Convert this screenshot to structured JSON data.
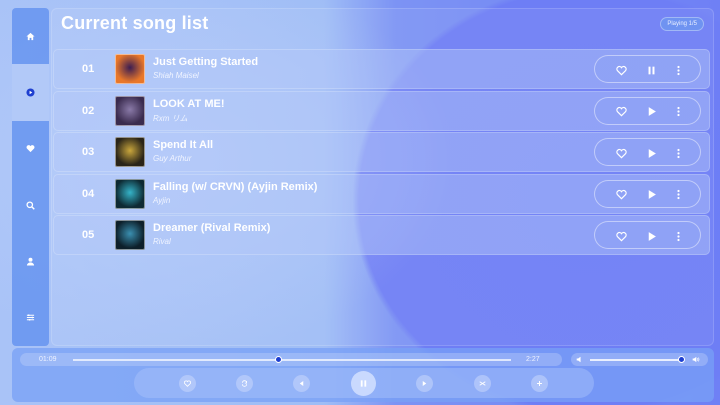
{
  "app": {
    "title": "Current song list",
    "badge": "Playing 1/5"
  },
  "sidebar": {
    "items": [
      {
        "icon": "home-icon",
        "active": false
      },
      {
        "icon": "play-circle-icon",
        "active": true
      },
      {
        "icon": "heart-icon",
        "active": false
      },
      {
        "icon": "search-icon",
        "active": false
      },
      {
        "icon": "user-icon",
        "active": false
      },
      {
        "icon": "sliders-icon",
        "active": false
      }
    ]
  },
  "songs": [
    {
      "number": "01",
      "title": "Just Getting Started",
      "artist": "Shiah Maisel",
      "state": "playing",
      "cover_colors": [
        "#e8772a",
        "#3b1d52"
      ]
    },
    {
      "number": "02",
      "title": "LOOK AT ME!",
      "artist": "Rxm リム",
      "state": "paused",
      "cover_colors": [
        "#3a2b4e",
        "#8a7aa8"
      ]
    },
    {
      "number": "03",
      "title": "Spend It All",
      "artist": "Guy Arthur",
      "state": "paused",
      "cover_colors": [
        "#2a2418",
        "#c9a63c"
      ]
    },
    {
      "number": "04",
      "title": "Falling (w/ CRVN) (Ayjin Remix)",
      "artist": "Ayjin",
      "state": "paused",
      "cover_colors": [
        "#0e2a33",
        "#35b3c8"
      ]
    },
    {
      "number": "05",
      "title": "Dreamer (Rival Remix)",
      "artist": "Rival",
      "state": "paused",
      "cover_colors": [
        "#0d1f2a",
        "#3a8fb0"
      ]
    }
  ],
  "player": {
    "current_time": "01:09",
    "total_time": "2:27",
    "progress": 0.47,
    "volume": 0.99
  },
  "colors": {
    "accent": "#1e3fd0",
    "sidebar": "#6694f0",
    "background": "#6f80f5"
  }
}
